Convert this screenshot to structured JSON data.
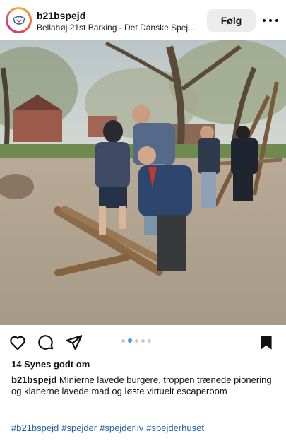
{
  "header": {
    "username": "b21bspejd",
    "subtitle": "Bellahøj 21st Barking - Det Danske Spej...",
    "follow_label": "Følg"
  },
  "post": {
    "likes_text": "14 Synes godt om",
    "caption_user": "b21bspejd",
    "caption_text": "Minierne lavede burgere, troppen trænede pionering og klanerne lavede mad og løste virtuelt escaperoom",
    "hashtags": [
      "#b21bspejd",
      "#spejder",
      "#spejderliv",
      "#spejderhuset"
    ]
  },
  "carousel": {
    "count": 5,
    "active_index": 1
  },
  "icons": {
    "like": "heart-icon",
    "comment": "comment-icon",
    "share": "send-icon",
    "save": "bookmark-icon",
    "more": "more-options-icon"
  },
  "colors": {
    "hashtag": "#1f5ca8",
    "follow_bg": "#ececec",
    "active_dot": "#3897f0"
  }
}
